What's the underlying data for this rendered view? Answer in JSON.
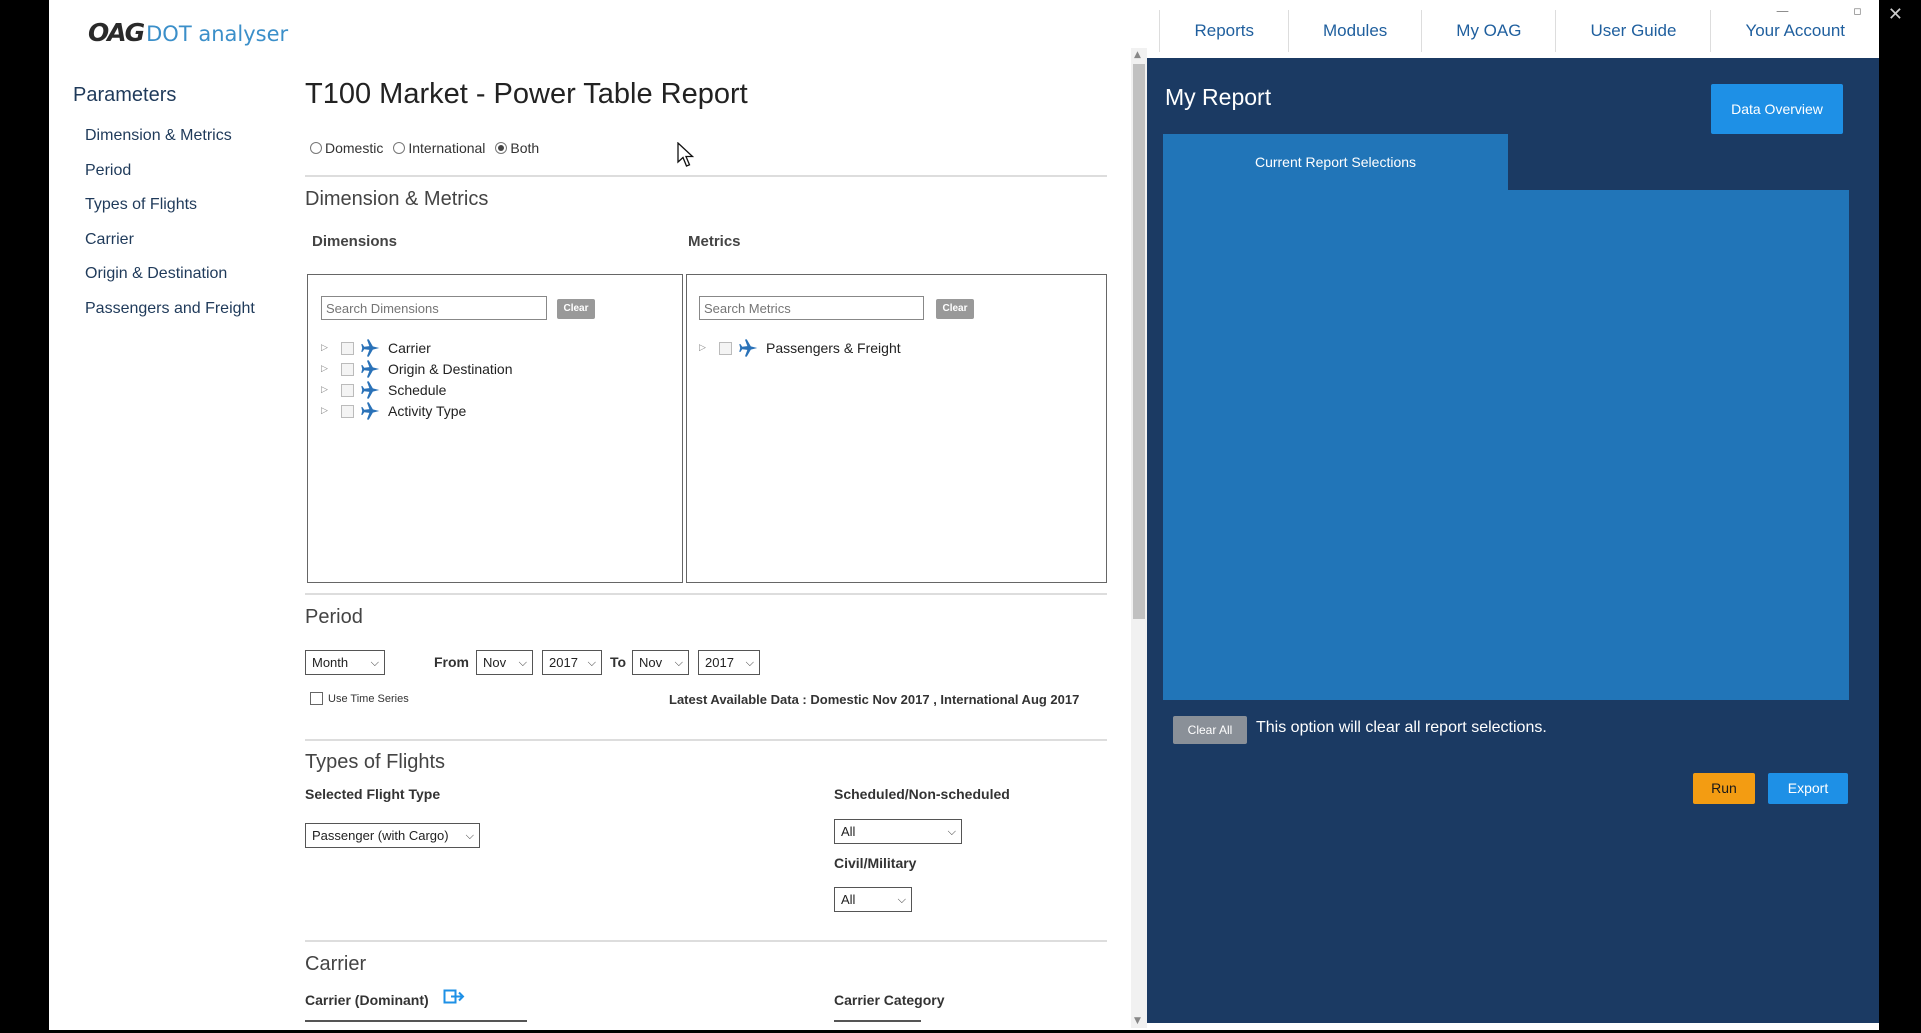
{
  "window": {
    "close_glyph": "✕",
    "minimize_glyph": "—",
    "restore_glyph": "▫"
  },
  "logo": {
    "brand": "OAG",
    "product": "DOT analyser"
  },
  "nav": [
    {
      "label": "Reports"
    },
    {
      "label": "Modules"
    },
    {
      "label": "My OAG"
    },
    {
      "label": "User Guide"
    },
    {
      "label": "Your Account"
    }
  ],
  "params": {
    "title": "Parameters",
    "items": [
      "Dimension & Metrics",
      "Period",
      "Types of Flights",
      "Carrier",
      "Origin & Destination",
      "Passengers and Freight"
    ]
  },
  "form": {
    "title": "T100 Market - Power Table Report",
    "scope": {
      "options": [
        "Domestic",
        "International",
        "Both"
      ],
      "selected": "Both"
    },
    "help_glyph": "?",
    "dim_metrics": {
      "title": "Dimension & Metrics",
      "dimensions_label": "Dimensions",
      "metrics_label": "Metrics",
      "dim_search_placeholder": "Search Dimensions",
      "met_search_placeholder": "Search Metrics",
      "clear_label": "Clear",
      "dimensions": [
        "Carrier",
        "Origin & Destination",
        "Schedule",
        "Activity Type"
      ],
      "metrics": [
        "Passengers & Freight"
      ]
    },
    "period": {
      "title": "Period",
      "granularity": "Month",
      "from_label": "From",
      "from_month": "Nov",
      "from_year": "2017",
      "to_label": "To",
      "to_month": "Nov",
      "to_year": "2017",
      "time_series_label": "Use Time Series",
      "latest": "Latest Available Data : Domestic Nov 2017 , International Aug 2017"
    },
    "flights": {
      "title": "Types of Flights",
      "flight_type_label": "Selected Flight Type",
      "flight_type_value": "Passenger (with Cargo)",
      "sched_label": "Scheduled/Non-scheduled",
      "sched_value": "All",
      "civil_label": "Civil/Military",
      "civil_value": "All"
    },
    "carrier": {
      "title": "Carrier",
      "dominant_label": "Carrier (Dominant)",
      "category_label": "Carrier Category"
    }
  },
  "report": {
    "title": "My Report",
    "data_overview": "Data Overview",
    "tab": "Current Report Selections",
    "clear_all": "Clear All",
    "clear_note": "This option will clear all report selections.",
    "run": "Run",
    "export": "Export"
  },
  "colors": {
    "panel": "#1b3a63",
    "selection": "#2175b8",
    "accent": "#1e90e6",
    "run": "#f39c12"
  }
}
